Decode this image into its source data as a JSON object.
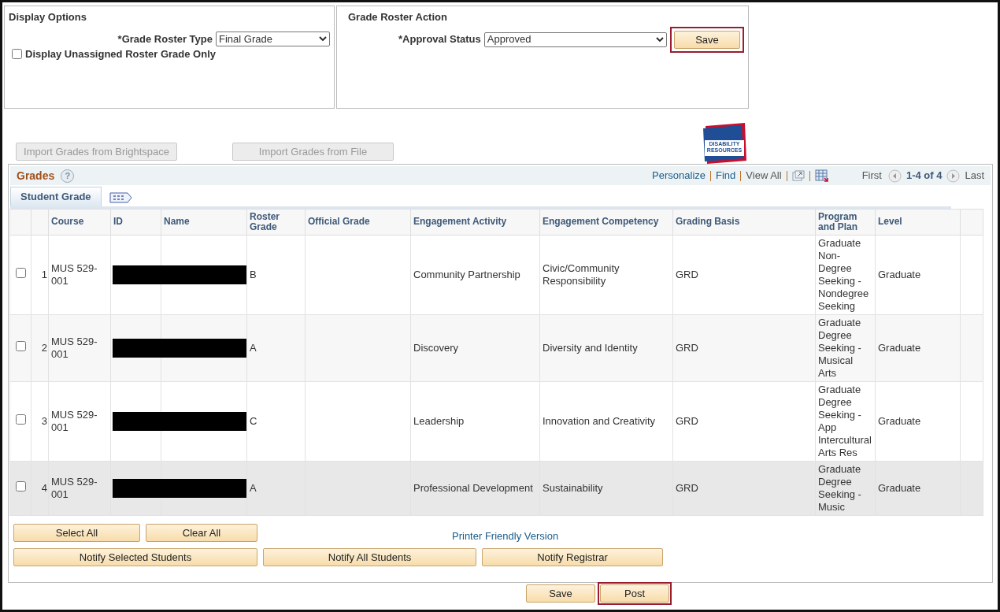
{
  "display_options": {
    "title": "Display Options",
    "grade_roster_type": {
      "label": "*Grade Roster Type",
      "value": "Final Grade"
    },
    "unassigned_only": {
      "label": "Display Unassigned Roster Grade Only",
      "checked": false
    }
  },
  "grade_roster_action": {
    "title": "Grade Roster Action",
    "approval_status": {
      "label": "*Approval Status",
      "value": "Approved"
    },
    "save": {
      "label": "Save",
      "highlighted": true
    }
  },
  "import_buttons": [
    {
      "label": "Import Grades from Brightspace",
      "disabled": true
    },
    {
      "label": "Import Grades from File",
      "disabled": true
    }
  ],
  "logo": {
    "text": "DISABILITY RESOURCES"
  },
  "grid": {
    "title": "Grades",
    "help": "?",
    "links": [
      "Personalize",
      "Find"
    ],
    "view_all": "View All",
    "nav": {
      "first": "First",
      "range": "1-4 of 4",
      "last": "Last"
    },
    "tabs": [
      {
        "label": "Student Grade",
        "selected": true
      }
    ],
    "columns": [
      "Course",
      "ID",
      "Name",
      "Roster Grade",
      "Official Grade",
      "Engagement Activity",
      "Engagement Competency",
      "Grading Basis",
      "Program and Plan",
      "Level"
    ],
    "rows": [
      {
        "checked": false,
        "highlighted": false,
        "number": "1",
        "course": "MUS 529-001",
        "roster_grade": "B",
        "activity": "Community Partnership",
        "competency": "Civic/Community Responsibility",
        "basis": "GRD",
        "program": "Graduate Non-Degree Seeking - Nondegree Seeking",
        "level": "Graduate"
      },
      {
        "checked": false,
        "highlighted": false,
        "number": "2",
        "course": "MUS 529-001",
        "roster_grade": "A",
        "activity": "Discovery",
        "competency": "Diversity and Identity",
        "basis": "GRD",
        "program": "Graduate Degree Seeking - Musical Arts",
        "level": "Graduate"
      },
      {
        "checked": false,
        "highlighted": false,
        "number": "3",
        "course": "MUS 529-001",
        "roster_grade": "C",
        "activity": "Leadership",
        "competency": "Innovation and Creativity",
        "basis": "GRD",
        "program": "Graduate Degree Seeking - App Intercultural Arts Res",
        "level": "Graduate"
      },
      {
        "checked": false,
        "highlighted": true,
        "number": "4",
        "course": "MUS 529-001",
        "roster_grade": "A",
        "activity": "Professional Development",
        "competency": "Sustainability",
        "basis": "GRD",
        "program": "Graduate Degree Seeking - Music",
        "level": "Graduate"
      }
    ]
  },
  "select_buttons": [
    "Select All",
    "Clear All"
  ],
  "printer_link": "Printer Friendly Version",
  "notify_buttons": [
    "Notify Selected Students",
    "Notify All Students",
    "Notify Registrar"
  ],
  "bottom_buttons": [
    {
      "label": "Save",
      "highlighted": false
    },
    {
      "label": "Post",
      "highlighted": true
    }
  ]
}
